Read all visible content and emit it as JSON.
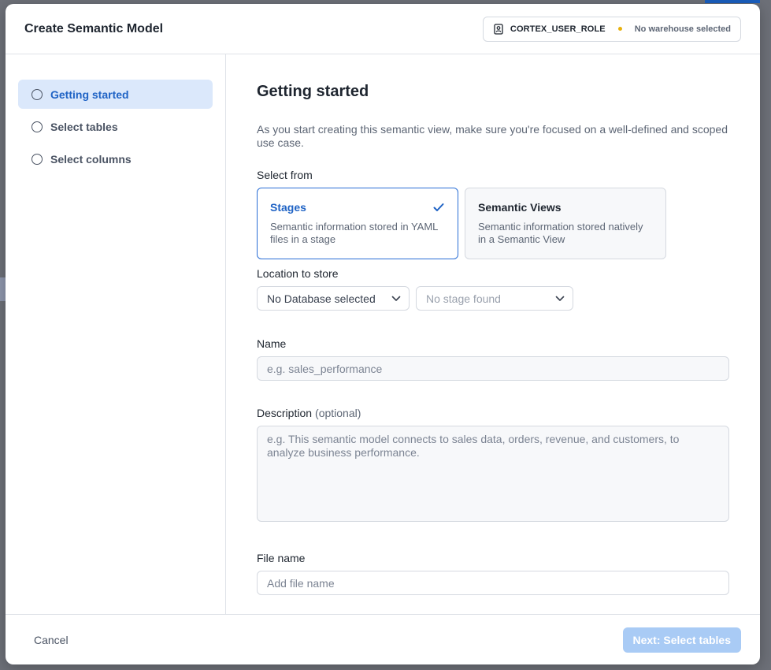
{
  "modal": {
    "title": "Create Semantic Model",
    "role": "CORTEX_USER_ROLE",
    "warehouse_status": "No warehouse selected"
  },
  "steps": [
    {
      "label": "Getting started",
      "active": true
    },
    {
      "label": "Select tables",
      "active": false
    },
    {
      "label": "Select columns",
      "active": false
    }
  ],
  "content": {
    "heading": "Getting started",
    "intro": "As you start creating this semantic view, make sure you're focused on a well-defined and scoped use case.",
    "select_from_label": "Select from",
    "cards": [
      {
        "title": "Stages",
        "desc": "Semantic information stored in YAML files in a stage",
        "selected": true
      },
      {
        "title": "Semantic Views",
        "desc": "Semantic information stored natively in a Semantic View",
        "selected": false
      }
    ],
    "location_label": "Location to store",
    "database_select": "No Database selected",
    "stage_select": "No stage found",
    "name_label": "Name",
    "name_placeholder": "e.g. sales_performance",
    "description_label": "Description",
    "description_optional": "(optional)",
    "description_placeholder": "e.g. This semantic model connects to sales data, orders, revenue, and customers, to analyze business performance.",
    "file_name_label": "File name",
    "file_name_placeholder": "Add file name"
  },
  "footer": {
    "cancel_label": "Cancel",
    "next_label": "Next: Select tables"
  },
  "colors": {
    "accent": "#1f63c5",
    "active_step_bg": "#dbe8fb",
    "next_button_disabled": "#a9cbf5",
    "warehouse_dot": "#e8b10c"
  }
}
